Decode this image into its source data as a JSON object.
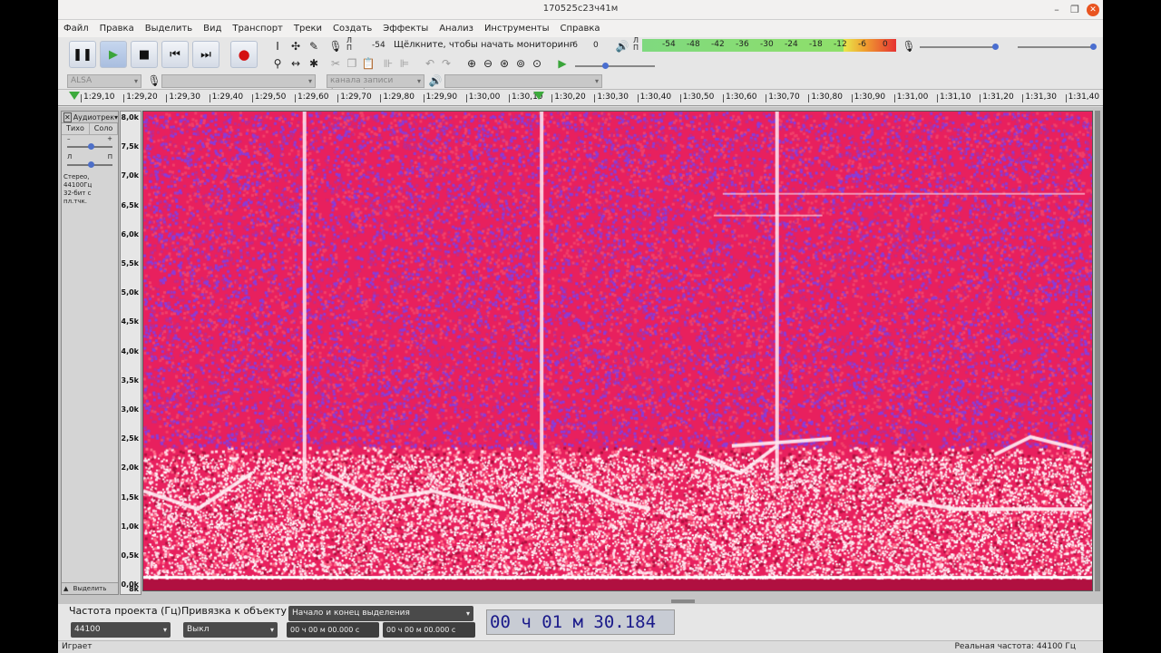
{
  "window": {
    "title": "170525c23ч41м"
  },
  "menu": [
    "Файл",
    "Правка",
    "Выделить",
    "Вид",
    "Транспорт",
    "Треки",
    "Создать",
    "Эффекты",
    "Анализ",
    "Инструменты",
    "Справка"
  ],
  "meters": {
    "rec_l": "Л",
    "rec_r": "П",
    "rec_left_tick": "-54",
    "rec_prompt": "Щёлкните, чтобы начать мониторинг",
    "rec_tick_a": "-6",
    "rec_tick_b": "0",
    "play_l": "Л",
    "play_r": "П",
    "play_ticks": [
      "-54",
      "-48",
      "-42",
      "-36",
      "-30",
      "-24",
      "-18",
      "-12",
      "-6",
      "0"
    ]
  },
  "device": {
    "host": "ALSA",
    "rec_channels": "канала записи (стерео)"
  },
  "ruler": {
    "ticks": [
      "1:29,10",
      "1:29,20",
      "1:29,30",
      "1:29,40",
      "1:29,50",
      "1:29,60",
      "1:29,70",
      "1:29,80",
      "1:29,90",
      "1:30,00",
      "1:30,10",
      "1:30,20",
      "1:30,30",
      "1:30,40",
      "1:30,50",
      "1:30,60",
      "1:30,70",
      "1:30,80",
      "1:30,90",
      "1:31,00",
      "1:31,10",
      "1:31,20",
      "1:31,30",
      "1:31,40"
    ]
  },
  "track": {
    "name": "Аудиотрек",
    "mute": "Тихо",
    "solo": "Соло",
    "gain_minus": "–",
    "gain_plus": "+",
    "pan_l": "Л",
    "pan_r": "П",
    "info_line1": "Стерео, 44100Гц",
    "info_line2": "32-бит с пл.тчк.",
    "select": "Выделить",
    "gain_level": 0.5,
    "pan_level": 0.5
  },
  "scale": [
    "8,0k",
    "7,5k",
    "7,0k",
    "6,5k",
    "6,0k",
    "5,5k",
    "5,0k",
    "4,5k",
    "4,0k",
    "3,5k",
    "3,0k",
    "2,5k",
    "2,0k",
    "1,5k",
    "1,0k",
    "0,5k",
    "0,0k",
    "8k"
  ],
  "bottom": {
    "rate_label": "Частота проекта (Гц)",
    "snap_label": "Привязка к объекту",
    "rate_value": "44100",
    "snap_value": "Выкл",
    "sel_mode": "Начало и конец выделения",
    "sel_start": "00 ч 00 м 00.000 с",
    "sel_end": "00 ч 00 м 00.000 с",
    "position": "00 ч 01 м 30.184 с"
  },
  "status": {
    "left": "Играет",
    "right": "Реальная частота: 44100 Гц"
  },
  "colors": {
    "spectro_bg": "#e8205e",
    "spectro_hot": "#ffe8f0",
    "spectro_cool": "#8a3cd8"
  }
}
